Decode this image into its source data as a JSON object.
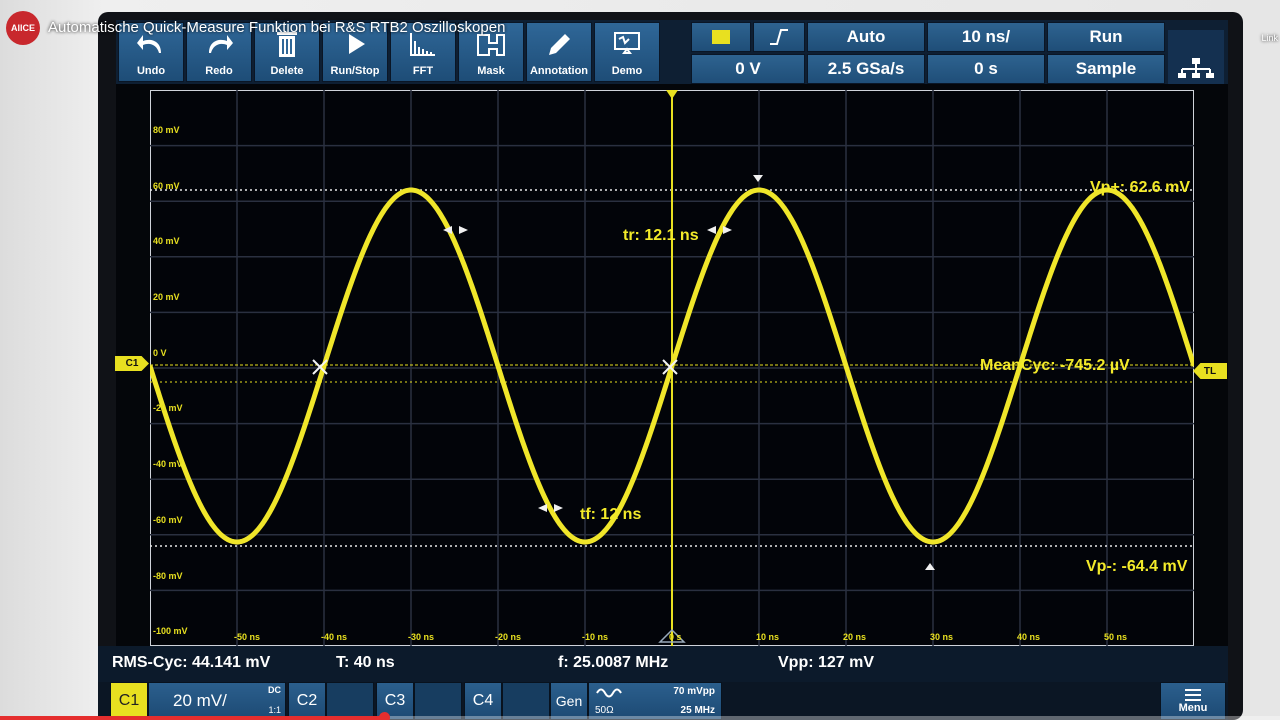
{
  "video": {
    "title": "Automatische Quick-Measure Funktion bei R&S RTB2 Oszilloskopen",
    "logo_text": "AllCE",
    "link_text": "Link",
    "progress": 0.3
  },
  "toolbar": {
    "buttons": [
      {
        "label": "Undo",
        "icon": "undo-icon"
      },
      {
        "label": "Redo",
        "icon": "redo-icon"
      },
      {
        "label": "Delete",
        "icon": "trash-icon"
      },
      {
        "label": "Run/Stop",
        "icon": "play-icon"
      },
      {
        "label": "FFT",
        "icon": "fft-icon"
      },
      {
        "label": "Mask",
        "icon": "mask-icon"
      },
      {
        "label": "Annotation",
        "icon": "pencil-icon"
      },
      {
        "label": "Demo",
        "icon": "demo-icon"
      }
    ],
    "trigger": {
      "level": "0 V",
      "mode": "Auto",
      "sample_rate": "2.5 GSa/s",
      "timebase": "10 ns/",
      "offset": "0 s",
      "state": "Run",
      "acq": "Sample"
    }
  },
  "grid": {
    "y_labels": [
      "80 mV",
      "60 mV",
      "40 mV",
      "20 mV",
      "0 V",
      "-20 mV",
      "-40 mV",
      "-60 mV",
      "-80 mV",
      "-100 mV"
    ],
    "x_labels": [
      "-50 ns",
      "-40 ns",
      "-30 ns",
      "-20 ns",
      "-10 ns",
      "0 s",
      "10 ns",
      "20 ns",
      "30 ns",
      "40 ns",
      "50 ns"
    ],
    "channel_marker": "C1",
    "trigger_marker": "TL"
  },
  "measurements": {
    "vp_plus": "Vp+: 62.6 mV",
    "vp_minus": "Vp-: -64.4 mV",
    "tr": "tr: 12.1 ns",
    "tf": "tf: 12 ns",
    "mean": "MeanCyc: -745.2 µV"
  },
  "results": {
    "rms": "RMS-Cyc: 44.141 mV",
    "period": "T: 40 ns",
    "freq": "f: 25.0087 MHz",
    "vpp": "Vpp: 127 mV"
  },
  "channels": {
    "c1": "C1",
    "c1_scale": "20 mV/",
    "c1_coupling": "DC",
    "c1_ratio": "1:1",
    "c2": "C2",
    "c3": "C3",
    "c4": "C4",
    "gen": "Gen",
    "gen_amp": "70 mVpp",
    "gen_imp": "50Ω",
    "gen_freq": "25 MHz",
    "menu": "Menu"
  },
  "colors": {
    "trace": "#f0e62a",
    "grid": "#2a3040",
    "panel": "#1f4e78"
  }
}
